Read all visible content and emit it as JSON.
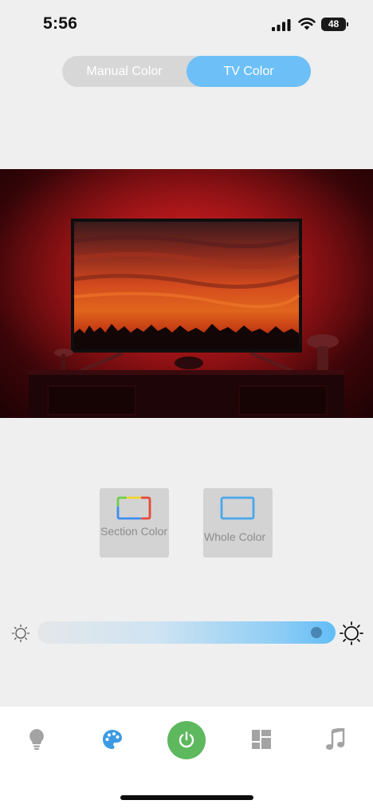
{
  "status_bar": {
    "time": "5:56",
    "battery": "48",
    "icons": [
      "signal-icon",
      "wifi-icon",
      "battery-icon"
    ]
  },
  "mode_switch": {
    "manual_label": "Manual Color",
    "tv_label": "TV Color",
    "selected": "TV Color",
    "accent_color": "#6cc0f7"
  },
  "preview": {
    "icon": "tv-backlight-photo"
  },
  "modes": {
    "section": {
      "label": "Section Color",
      "icon": "section-color-icon"
    },
    "whole": {
      "label": "Whole Color",
      "icon": "whole-color-icon"
    }
  },
  "brightness": {
    "level": 0.97,
    "icons": [
      "sun-small-icon",
      "sun-large-icon"
    ]
  },
  "tab_bar": {
    "items": [
      {
        "name": "bulb",
        "icon": "bulb-icon"
      },
      {
        "name": "palette",
        "icon": "palette-icon",
        "active": true
      },
      {
        "name": "power",
        "icon": "power-icon",
        "color": "#5db85e"
      },
      {
        "name": "scenes",
        "icon": "scenes-icon"
      },
      {
        "name": "music",
        "icon": "music-note-icon"
      }
    ]
  }
}
